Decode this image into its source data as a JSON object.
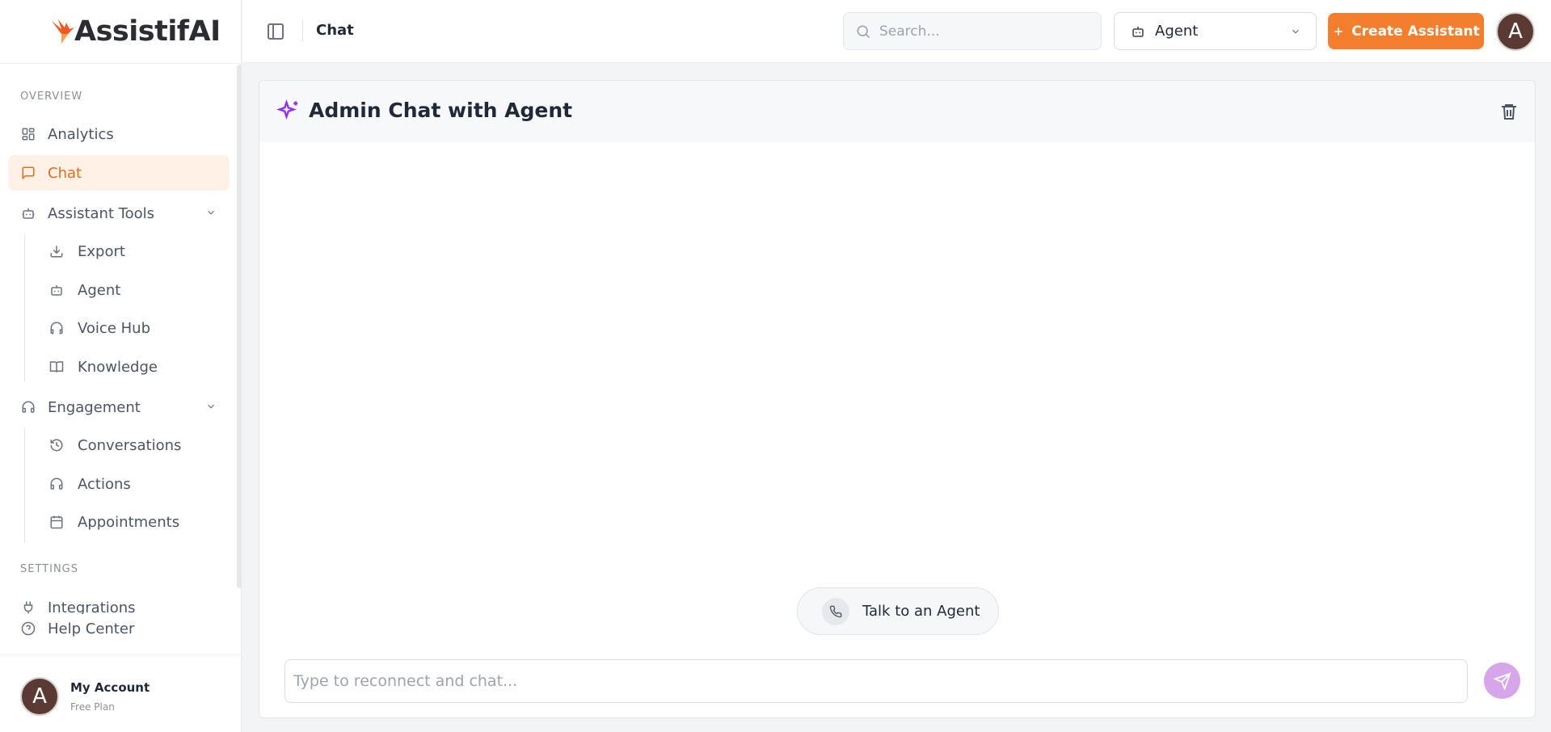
{
  "brand": {
    "name": "AssistifAI",
    "accent": "#f37f2e"
  },
  "sidebar": {
    "overview_label": "OVERVIEW",
    "settings_label": "SETTINGS",
    "items": [
      {
        "label": "Analytics",
        "icon": "grid-icon"
      },
      {
        "label": "Chat",
        "icon": "message-square-icon",
        "active": true
      },
      {
        "label": "Assistant Tools",
        "icon": "bot-icon",
        "expanded": true
      },
      {
        "label": "Engagement",
        "icon": "headset-icon",
        "expanded": true
      }
    ],
    "assistant_tools": [
      {
        "label": "Export",
        "icon": "download-icon"
      },
      {
        "label": "Agent",
        "icon": "bot-icon"
      },
      {
        "label": "Voice Hub",
        "icon": "headphones-icon"
      },
      {
        "label": "Knowledge",
        "icon": "book-open-icon"
      }
    ],
    "engagement": [
      {
        "label": "Conversations",
        "icon": "history-icon"
      },
      {
        "label": "Actions",
        "icon": "headset-icon"
      },
      {
        "label": "Appointments",
        "icon": "calendar-icon"
      }
    ],
    "settings_items": [
      {
        "label": "Integrations",
        "icon": "plug-icon"
      }
    ],
    "help_label": "Help Center",
    "account": {
      "name": "My Account",
      "plan": "Free Plan",
      "avatar_letter": "A"
    }
  },
  "header": {
    "breadcrumb": "Chat",
    "search_placeholder": "Search...",
    "agent_select": "Agent",
    "create_label": "Create Assistant",
    "avatar_letter": "A"
  },
  "chat": {
    "title": "Admin Chat with Agent",
    "talk_label": "Talk to an Agent",
    "input_placeholder": "Type to reconnect and chat..."
  }
}
